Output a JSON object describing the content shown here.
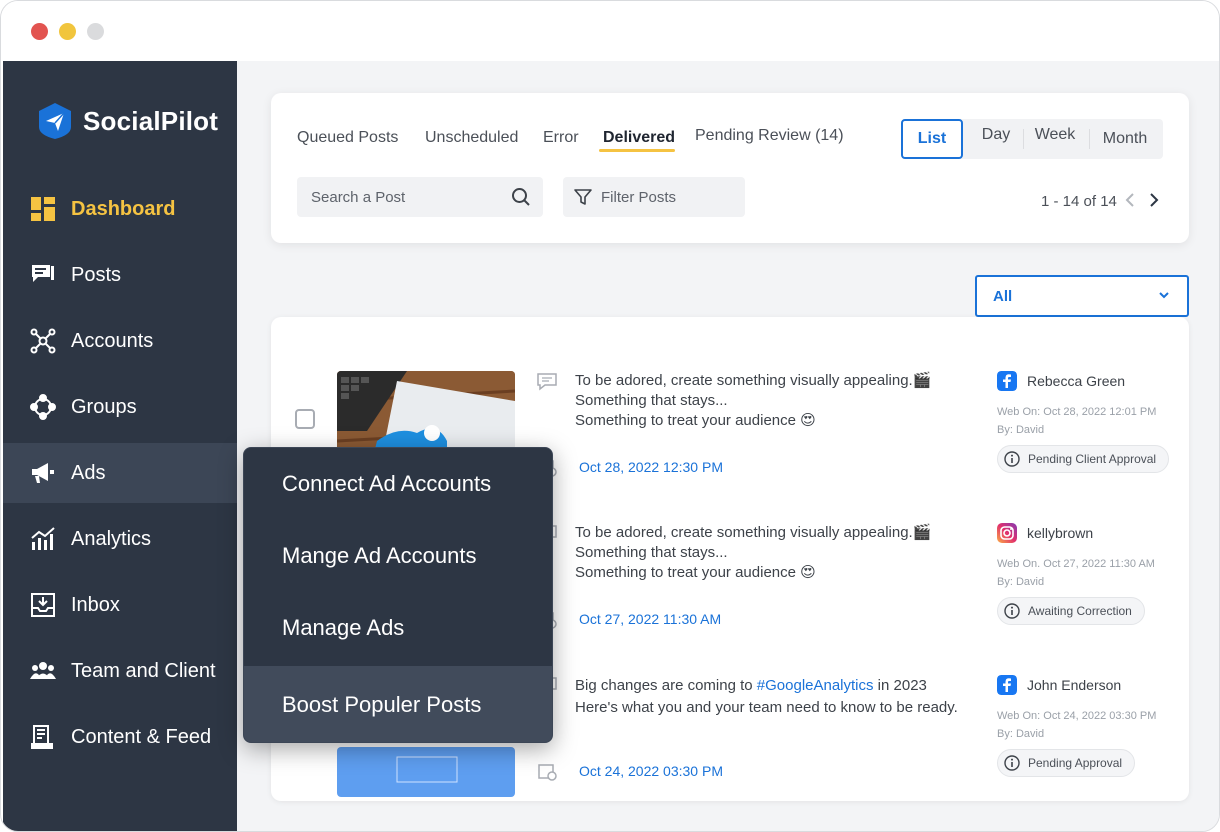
{
  "brand": {
    "name": "SocialPilot",
    "accent": "#1a72d8",
    "highlight": "#f5c342",
    "sidebar_bg": "#2d3644"
  },
  "sidebar": {
    "items": [
      {
        "label": "Dashboard",
        "icon": "dashboard-icon",
        "active": true
      },
      {
        "label": "Posts",
        "icon": "posts-icon"
      },
      {
        "label": "Accounts",
        "icon": "accounts-icon"
      },
      {
        "label": "Groups",
        "icon": "groups-icon"
      },
      {
        "label": "Ads",
        "icon": "megaphone-icon",
        "hover": true
      },
      {
        "label": "Analytics",
        "icon": "analytics-icon"
      },
      {
        "label": "Inbox",
        "icon": "inbox-icon"
      },
      {
        "label": "Team and Client",
        "icon": "team-icon"
      },
      {
        "label": "Content & Feed",
        "icon": "content-feed-icon"
      }
    ]
  },
  "ads_menu": {
    "items": [
      {
        "label": "Connect Ad Accounts"
      },
      {
        "label": "Mange Ad Accounts"
      },
      {
        "label": "Manage Ads"
      },
      {
        "label": "Boost Populer Posts",
        "highlighted": true
      }
    ]
  },
  "tabs": [
    {
      "label": "Queued Posts"
    },
    {
      "label": "Unscheduled"
    },
    {
      "label": "Error"
    },
    {
      "label": "Delivered",
      "active": true
    },
    {
      "label": "Pending Review (14)"
    }
  ],
  "views": {
    "list": "List",
    "day": "Day",
    "week": "Week",
    "month": "Month",
    "selected": "List"
  },
  "search": {
    "placeholder": "Search a Post"
  },
  "filter": {
    "label": "Filter Posts"
  },
  "pagination": {
    "text": "1 - 14 of 14"
  },
  "account_filter": {
    "selected": "All"
  },
  "posts": [
    {
      "text_lines": [
        "To be adored, create something visually appealing.🎬",
        "Something that stays...",
        "Something to treat your audience 😍"
      ],
      "date": "Oct 28, 2022 12:30 PM",
      "network": "facebook",
      "account": "Rebecca Green",
      "web_on": "Web On: Oct 28, 2022 12:01 PM",
      "by": "By: David",
      "status": "Pending Client Approval"
    },
    {
      "text_lines": [
        "To be adored, create something visually appealing.🎬",
        "Something that stays...",
        "Something to treat your audience 😍"
      ],
      "date": "Oct 27, 2022 11:30 AM",
      "network": "instagram",
      "account": "kellybrown",
      "web_on": "Web On. Oct 27, 2022 11:30 AM",
      "by": "By: David",
      "status": "Awaiting Correction"
    },
    {
      "text_before": "Big changes are coming to ",
      "hashtag": "#GoogleAnalytics",
      "text_after": " in 2023",
      "text_line2": "Here's what you and your team need to know to be ready.",
      "date": "Oct 24, 2022 03:30 PM",
      "network": "facebook",
      "account": "John Enderson",
      "web_on": "Web On: Oct 24, 2022 03:30 PM",
      "by": "By: David",
      "status": "Pending Approval"
    }
  ]
}
